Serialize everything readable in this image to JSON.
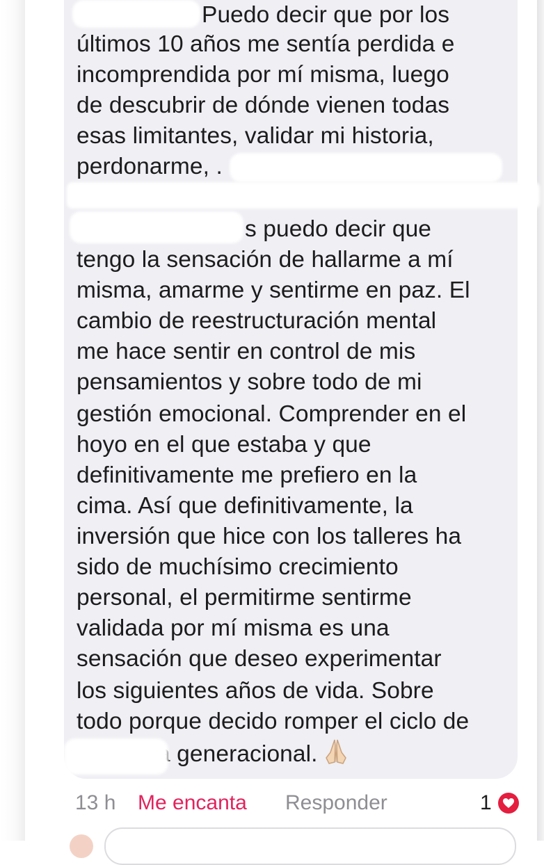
{
  "comment": {
    "lines": [
      "Puedo decir que por los",
      "últimos 10 años me sentía perdida e",
      "incomprendida por mí misma, luego",
      "de descubrir de dónde vienen todas",
      "esas limitantes, validar mi historia,",
      "perdonarme, .",
      "",
      "s puedo decir que",
      "tengo la sensación de hallarme a mí",
      "misma, amarme y sentirme en paz. El",
      "cambio de reestructuración mental",
      "me hace sentir en control de mis",
      "pensamientos y sobre todo de mi",
      "gestión emocional. Comprender en el",
      "hoyo en el que estaba y que",
      "definitivamente me prefiero en la",
      "cima. Así que definitivamente, la",
      "inversión que hice con los talleres ha",
      "sido de muchísimo crecimiento",
      "personal, el permitirme sentirme",
      "validada por mí misma es una",
      "sensación que deseo experimentar",
      "los siguientes años de vida. Sobre",
      "todo porque decido romper el ciclo de",
      "a generacional."
    ],
    "emoji_icon": "folded-hands-icon"
  },
  "actions": {
    "time": "13 h",
    "reaction_label": "Me encanta",
    "reply_label": "Responder",
    "reaction_count": "1",
    "reaction_icon": "heart-icon"
  },
  "colors": {
    "bubble": "#efeff4",
    "text": "#1c1c1e",
    "meta": "#8e8e93",
    "love": "#e0245e",
    "heart": "#e41e3f"
  }
}
